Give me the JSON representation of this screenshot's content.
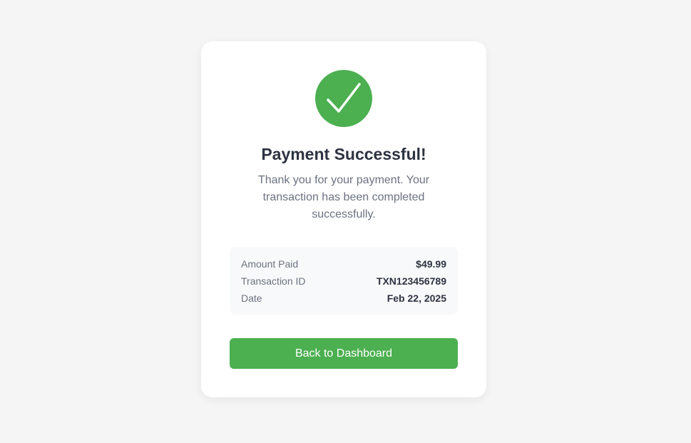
{
  "colors": {
    "background": "#f5f5f5",
    "card": "#ffffff",
    "accent": "#4caf50",
    "heading": "#2d3340",
    "muted": "#6b7280",
    "details_bg": "#f8f9fa"
  },
  "status": {
    "icon": "check-circle-icon",
    "title": "Payment Successful!",
    "message": "Thank you for your payment. Your transaction has been completed successfully."
  },
  "details": {
    "rows": [
      {
        "label": "Amount Paid",
        "value": "$49.99"
      },
      {
        "label": "Transaction ID",
        "value": "TXN123456789"
      },
      {
        "label": "Date",
        "value": "Feb 22, 2025"
      }
    ]
  },
  "actions": {
    "back_label": "Back to Dashboard"
  }
}
